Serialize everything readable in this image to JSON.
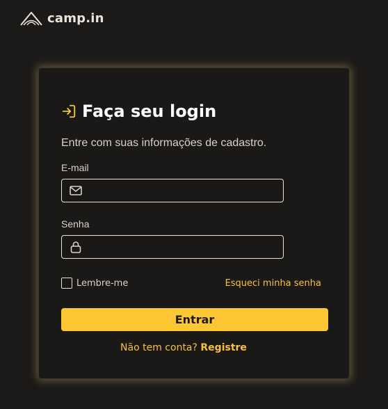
{
  "brand": {
    "name": "camp.in",
    "icon": "tent-icon"
  },
  "login": {
    "icon": "sign-in-icon",
    "title": "Faça seu login",
    "subtitle": "Entre com suas informações de cadastro.",
    "email": {
      "label": "E-mail",
      "value": "",
      "placeholder": "",
      "icon": "mail-icon"
    },
    "password": {
      "label": "Senha",
      "value": "",
      "placeholder": "",
      "icon": "lock-icon"
    },
    "remember_label": "Lembre-me",
    "remember_checked": false,
    "forgot_label": "Esqueci minha senha",
    "submit_label": "Entrar",
    "signup_prompt": "Não tem conta?",
    "signup_link": "Registre"
  },
  "colors": {
    "accent": "#fcc634",
    "link": "#f5c23a",
    "background": "#1c1a19",
    "text": "#d6d3cc"
  }
}
